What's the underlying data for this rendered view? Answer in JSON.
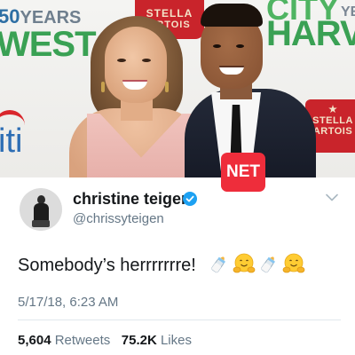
{
  "photo": {
    "backdrop": {
      "years_number": "50",
      "years_word": "YEARS",
      "west": "WEST",
      "city": "CITY",
      "ye": "YE",
      "harvest": "HARV",
      "citi": "iti",
      "stella_top_l1": "STELLA",
      "stella_top_l2": "ARTOIS",
      "stella_right_l1": "STELLA",
      "stella_right_l2": "ARTOIS"
    },
    "watermark": "NET"
  },
  "tweet": {
    "display_name": "christine teigen",
    "handle": "@chrissyteigen",
    "text": "Somebody’s herrrrrrre!",
    "emojis": [
      "baby-bottle-icon",
      "hugging-face-icon",
      "baby-bottle-icon",
      "hugging-face-icon"
    ],
    "timestamp": "5/17/18, 6:23 AM",
    "retweets_count": "5,604",
    "retweets_label": "Retweets",
    "likes_count": "75.2K",
    "likes_label": "Likes"
  },
  "colors": {
    "verified_blue": "#1da1f2",
    "secondary_text": "#657786",
    "primary_text": "#14171a",
    "net_red": "#ee2d3b"
  }
}
